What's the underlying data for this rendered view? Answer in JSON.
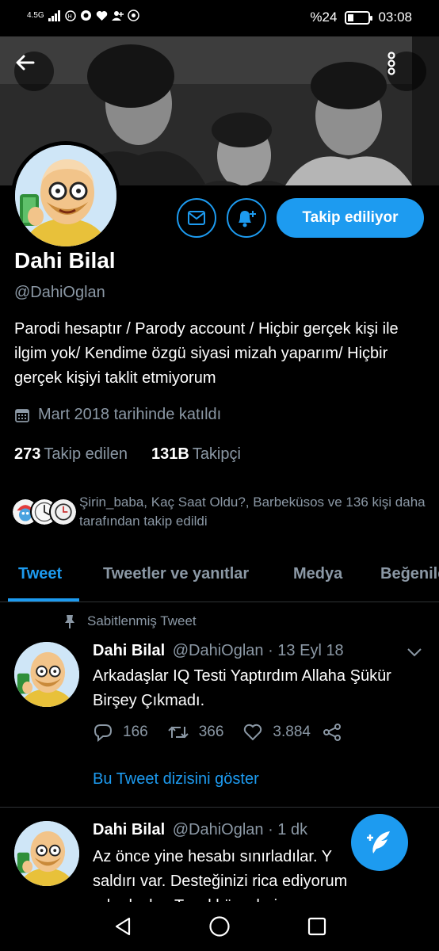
{
  "status_bar": {
    "network": "4.5G",
    "battery_text": "%24",
    "battery_level": 0.24,
    "time": "03:08"
  },
  "header": {
    "back_icon": "arrow-left-icon",
    "more_icon": "more-vertical-icon"
  },
  "profile": {
    "name": "Dahi Bilal",
    "handle": "@DahiOglan",
    "bio": "Parodi hesaptır / Parody account / Hiçbir gerçek kişi ile ilgim yok/ Kendime özgü siyasi mizah yaparım/ Hiçbir gerçek kişiyi taklit etmiyorum",
    "joined": "Mart 2018 tarihinde katıldı",
    "following_count": "273",
    "following_label": "Takip edilen",
    "followers_count": "131B",
    "followers_label": "Takipçi",
    "followed_by": "Şirin_baba, Kaç Saat Oldu?, Barbeküsos ve 136 kişi daha tarafından takip edildi"
  },
  "actions": {
    "message_icon": "mail-icon",
    "notify_icon": "bell-plus-icon",
    "follow_label": "Takip ediliyor"
  },
  "tabs": [
    {
      "label": "Tweet"
    },
    {
      "label": "Tweetler ve yanıtlar"
    },
    {
      "label": "Medya"
    },
    {
      "label": "Beğeniler"
    }
  ],
  "pinned_tweet": {
    "pinned_label": "Sabitlenmiş Tweet",
    "name": "Dahi Bilal",
    "handle": "@DahiOglan",
    "date": "· 13 Eyl 18",
    "text": "Arkadaşlar IQ Testi Yaptırdım Allaha Şükür Birşey Çıkmadı.",
    "replies": "166",
    "retweets": "366",
    "likes": "3.884",
    "show_thread": "Bu Tweet dizisini göster"
  },
  "second_tweet": {
    "name": "Dahi Bilal",
    "handle": "@DahiOglan",
    "date": "· 1 dk",
    "line1": "Az önce yine hesabı sınırladılar. Y",
    "line2": "saldırı var. Desteğinizi rica ediyorum",
    "line3": "arkadaşlar. Teşekkür ederim"
  },
  "colors": {
    "accent": "#1d9bf0",
    "background": "#000000",
    "secondary_text": "#8b98a5"
  }
}
